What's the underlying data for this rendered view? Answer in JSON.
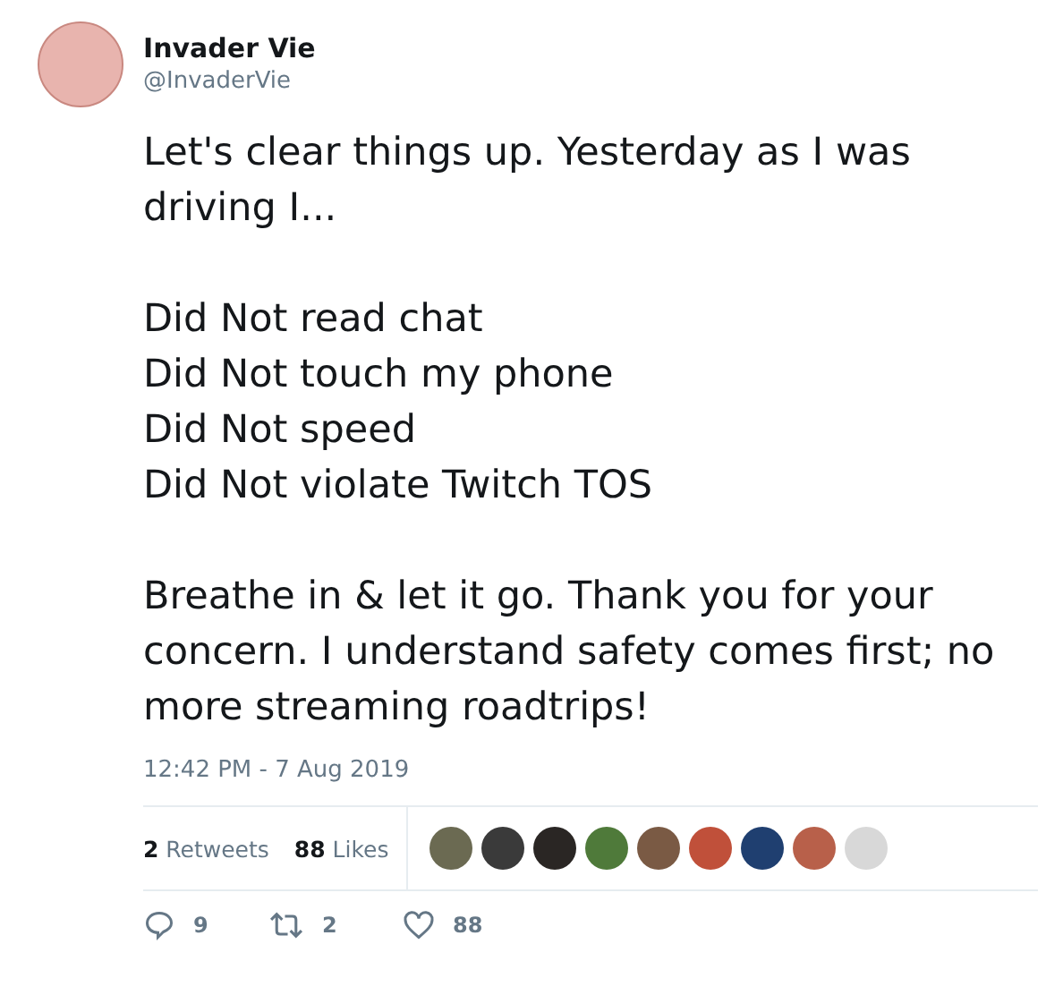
{
  "author": {
    "name": "Invader Vie",
    "handle": "@InvaderVie"
  },
  "body": {
    "paragraphs": [
      {
        "kind": "text",
        "text": "Let's clear things up. Yesterday as I was driving I..."
      },
      {
        "kind": "lines",
        "lines": [
          "Did Not read chat",
          "Did Not touch my phone",
          "Did Not speed",
          "Did Not violate Twitch TOS"
        ]
      },
      {
        "kind": "text",
        "text": "Breathe in & let it go. Thank you for your concern. I understand safety comes first; no more streaming roadtrips!"
      }
    ]
  },
  "timestamp": "12:42 PM - 7 Aug 2019",
  "stats": [
    {
      "count": "2",
      "label": "Retweets"
    },
    {
      "count": "88",
      "label": "Likes"
    }
  ],
  "likers": [
    {
      "color": "#6b6a52"
    },
    {
      "color": "#3a3a3a"
    },
    {
      "color": "#2a2624"
    },
    {
      "color": "#4f7a3a"
    },
    {
      "color": "#7a5a44"
    },
    {
      "color": "#c0503a"
    },
    {
      "color": "#1f3f70"
    },
    {
      "color": "#b8604a"
    },
    {
      "color": "#d8d8d8"
    }
  ],
  "actions": [
    {
      "kind": "reply",
      "count": "9"
    },
    {
      "kind": "retweet",
      "count": "2"
    },
    {
      "kind": "like",
      "count": "88"
    }
  ]
}
